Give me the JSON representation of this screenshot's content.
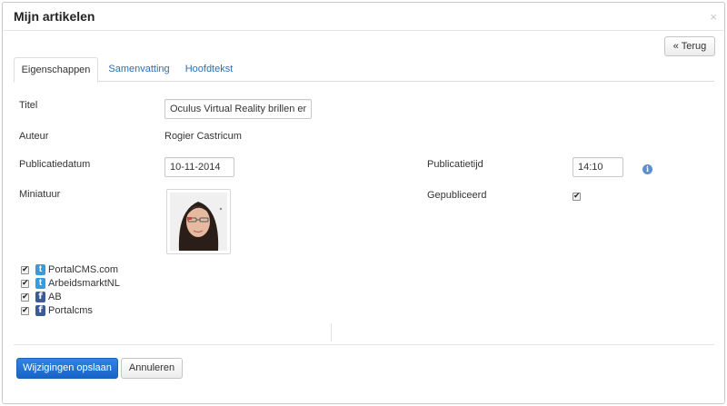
{
  "modal": {
    "title": "Mijn artikelen",
    "close_glyph": "×"
  },
  "toolbar": {
    "back_label": "« Terug"
  },
  "tabs": [
    {
      "label": "Eigenschappen",
      "active": true
    },
    {
      "label": "Samenvatting",
      "active": false
    },
    {
      "label": "Hoofdtekst",
      "active": false
    }
  ],
  "form": {
    "title_label": "Titel",
    "title_value": "Oculus Virtual Reality brillen en P",
    "author_label": "Auteur",
    "author_value": "Rogier Castricum",
    "pubdate_label": "Publicatiedatum",
    "pubdate_value": "10-11-2014",
    "pubtime_label": "Publicatietijd",
    "pubtime_value": "14:10",
    "info_glyph": "i",
    "thumbnail_label": "Miniatuur",
    "published_label": "Gepubliceerd",
    "published_checked": true
  },
  "social": [
    {
      "network": "twitter",
      "icon": "twitter-icon",
      "glyph": "t",
      "label": "PortalCMS.com",
      "checked": true
    },
    {
      "network": "twitter",
      "icon": "twitter-icon",
      "glyph": "t",
      "label": "ArbeidsmarktNL",
      "checked": true
    },
    {
      "network": "facebook",
      "icon": "facebook-icon",
      "glyph": "f",
      "label": "AB",
      "checked": true
    },
    {
      "network": "facebook",
      "icon": "facebook-icon",
      "glyph": "f",
      "label": "Portalcms",
      "checked": true
    }
  ],
  "footer": {
    "save_label": "Wijzigingen opslaan",
    "cancel_label": "Annuleren"
  },
  "colors": {
    "primary": "#1f6fd0",
    "link": "#2a6fb6",
    "twitter": "#3b9ad9",
    "facebook": "#3b5b98",
    "info": "#5b8fd0"
  },
  "checkbox_glyph": "✔"
}
